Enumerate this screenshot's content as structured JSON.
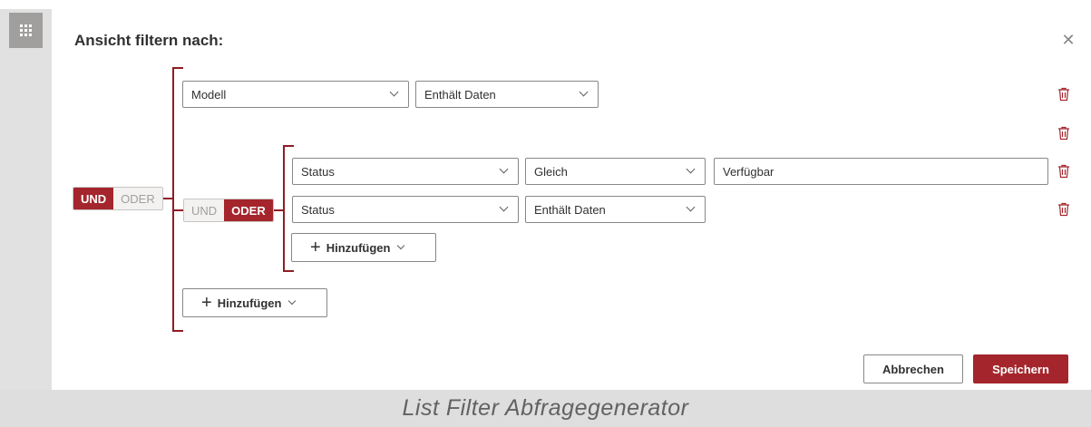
{
  "dialog": {
    "title": "Ansicht filtern nach:",
    "close_icon": "close-icon"
  },
  "outer_group": {
    "toggle": {
      "und": "UND",
      "oder": "ODER",
      "selected": "UND"
    },
    "rule1": {
      "field": "Modell",
      "operator": "Enthält Daten"
    },
    "add_label": "Hinzufügen"
  },
  "inner_group": {
    "toggle": {
      "und": "UND",
      "oder": "ODER",
      "selected": "ODER"
    },
    "rule1": {
      "field": "Status",
      "operator": "Gleich",
      "value": "Verfügbar"
    },
    "rule2": {
      "field": "Status",
      "operator": "Enthält Daten"
    },
    "add_label": "Hinzufügen"
  },
  "footer": {
    "cancel_label": "Abbrechen",
    "save_label": "Speichern"
  },
  "caption": "List Filter Abfragegenerator",
  "colors": {
    "accent": "#a4262c",
    "bracket": "#8f1d25",
    "rail": "#e1e1e1",
    "caption_bg": "#dedede"
  }
}
